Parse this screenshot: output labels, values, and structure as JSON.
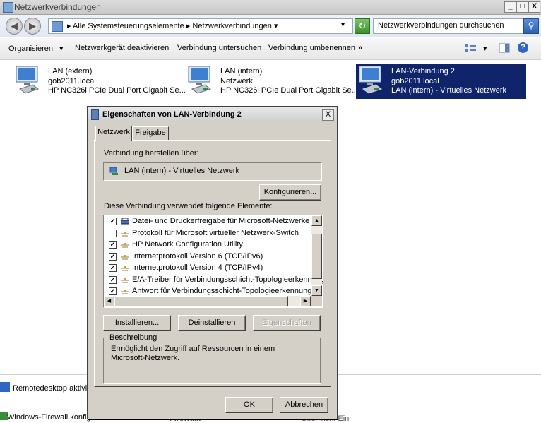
{
  "window": {
    "title": "Netzwerkverbindungen",
    "min_label": "_",
    "max_label": "□",
    "close_label": "X"
  },
  "address": {
    "crumbs": [
      "Alle Systemsteuerungselemente",
      "Netzwerkverbindungen"
    ],
    "separator": "▸",
    "dropdown": "▾",
    "search_placeholder": "Netzwerkverbindungen durchsuchen"
  },
  "toolbar": {
    "organize": "Organisieren",
    "organize_arrow": "▾",
    "disable": "Netzwerkgerät deaktivieren",
    "diagnose": "Verbindung untersuchen",
    "rename": "Verbindung umbenennen",
    "more": "»",
    "view_arrow": "▾",
    "help": "?"
  },
  "connections": [
    {
      "name": "LAN (extern)",
      "network": "gob2011.local",
      "device": "HP NC326i PCIe Dual Port Gigabit Se..."
    },
    {
      "name": "LAN (intern)",
      "network": "Netzwerk",
      "device": "HP NC326i PCIe Dual Port Gigabit Se..."
    },
    {
      "name": "LAN-Verbindung 2",
      "network": "gob2011.local",
      "device": "LAN (intern) - Virtuelles Netzwerk"
    }
  ],
  "lower_panel": {
    "remote": "Remotedesktop aktivie",
    "firewall": "Windows-Firewall konfigurieren",
    "firewall_col": "Firewall:",
    "firewall_val": "Öffentlich: Ein"
  },
  "dialog": {
    "title": "Eigenschaften von LAN-Verbindung 2",
    "close": "X",
    "tabs": [
      "Netzwerk",
      "Freigabe"
    ],
    "connect_via_label": "Verbindung herstellen über:",
    "adapter": "LAN (intern) - Virtuelles Netzwerk",
    "configure_button": "Konfigurieren...",
    "elements_label": "Diese Verbindung verwendet folgende Elemente:",
    "items": [
      {
        "label": "Datei- und Druckerfreigabe für Microsoft-Netzwerke",
        "checked": true,
        "icon": "printer-icon"
      },
      {
        "label": "Protokoll für Microsoft virtueller Netzwerk-Switch",
        "checked": false,
        "icon": "protocol-icon"
      },
      {
        "label": "HP Network Configuration Utility",
        "checked": true,
        "icon": "protocol-icon"
      },
      {
        "label": "Internetprotokoll Version 6 (TCP/IPv6)",
        "checked": true,
        "icon": "protocol-icon"
      },
      {
        "label": "Internetprotokoll Version 4 (TCP/IPv4)",
        "checked": true,
        "icon": "protocol-icon"
      },
      {
        "label": "E/A-Treiber für Verbindungsschicht-Topologieerkennung",
        "checked": true,
        "icon": "protocol-icon"
      },
      {
        "label": "Antwort für Verbindungsschicht-Topologieerkennung",
        "checked": true,
        "icon": "protocol-icon"
      }
    ],
    "install_button": "Installieren...",
    "uninstall_button": "Deinstallieren",
    "properties_button": "Eigenschaften",
    "description_title": "Beschreibung",
    "description_text": "Ermöglicht den Zugriff auf Ressourcen in einem Microsoft-Netzwerk.",
    "ok_button": "OK",
    "cancel_button": "Abbrechen"
  }
}
